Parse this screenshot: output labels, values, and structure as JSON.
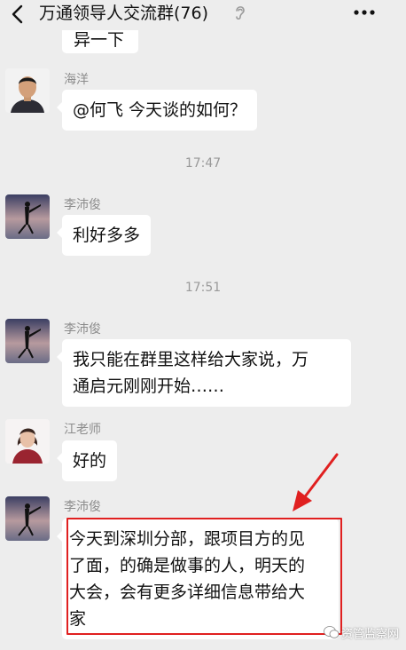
{
  "header": {
    "title": "万通领导人交流群(76)",
    "back_icon": "chevron-left-icon",
    "mute_icon": "ear-icon",
    "more_icon": "more-dots-icon"
  },
  "messages": [
    {
      "sender": "",
      "text": "异一下"
    },
    {
      "sender": "海洋",
      "text": "@何飞  今天谈的如何？"
    },
    {
      "time": "17:47"
    },
    {
      "sender": "李沛俊",
      "text": "利好多多"
    },
    {
      "time": "17:51"
    },
    {
      "sender": "李沛俊",
      "lines": [
        "我只能在群里这样给大家说，万",
        "通启元刚刚开始……"
      ]
    },
    {
      "sender": "江老师",
      "text": "好的"
    },
    {
      "sender": "李沛俊",
      "lines": [
        "今天到深圳分部，跟项目方的见",
        "了面，的确是做事的人，明天的",
        "大会，会有更多详细信息带给大",
        "家"
      ]
    }
  ],
  "watermark": {
    "text": "资管监察网"
  },
  "annotation_color": "#e02020",
  "colors": {
    "background": "#ededed",
    "bubble": "#ffffff",
    "sender": "#8c8c8c"
  }
}
